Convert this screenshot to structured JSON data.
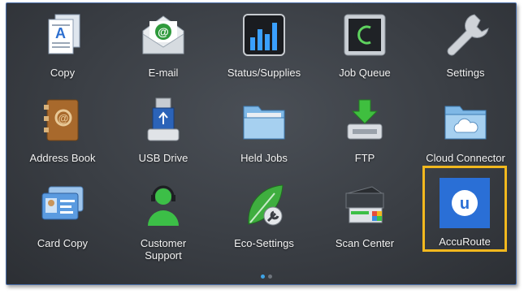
{
  "apps": [
    {
      "label": "Copy",
      "icon": "copy-document-icon"
    },
    {
      "label": "E-mail",
      "icon": "email-envelope-icon"
    },
    {
      "label": "Status/Supplies",
      "icon": "status-bars-icon"
    },
    {
      "label": "Job Queue",
      "icon": "job-queue-monitor-icon"
    },
    {
      "label": "Settings",
      "icon": "wrench-icon"
    },
    {
      "label": "Address Book",
      "icon": "address-book-icon"
    },
    {
      "label": "USB Drive",
      "icon": "usb-drive-icon"
    },
    {
      "label": "Held Jobs",
      "icon": "folder-icon"
    },
    {
      "label": "FTP",
      "icon": "ftp-download-icon"
    },
    {
      "label": "Cloud Connector",
      "icon": "cloud-folder-icon"
    },
    {
      "label": "Card Copy",
      "icon": "id-card-icon"
    },
    {
      "label": "Customer\nSupport",
      "icon": "headset-person-icon"
    },
    {
      "label": "Eco-Settings",
      "icon": "eco-leaf-wrench-icon"
    },
    {
      "label": "Scan Center",
      "icon": "scanner-icon"
    },
    {
      "label": "AccuRoute",
      "icon": "accuroute-logo-icon"
    }
  ],
  "selected_app": "AccuRoute",
  "selection_color": "#f2b81e",
  "page_indicator": {
    "pages": 2,
    "current": 1
  }
}
